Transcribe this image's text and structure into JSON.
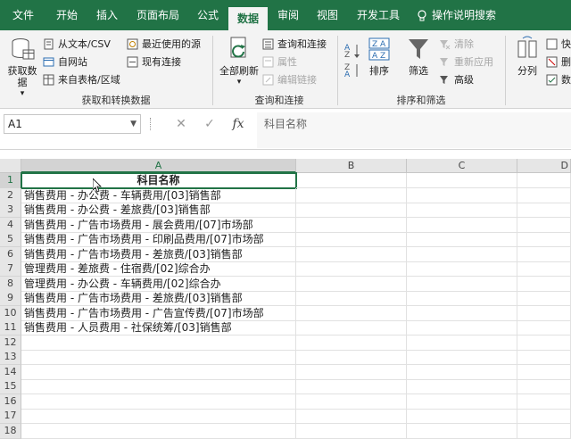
{
  "ribbon_tabs": [
    "文件",
    "开始",
    "插入",
    "页面布局",
    "公式",
    "数据",
    "审阅",
    "视图",
    "开发工具",
    "操作说明搜索"
  ],
  "active_tab": "数据",
  "colors": {
    "brand": "#217346",
    "ribbon_bg": "#f3f3f3",
    "header_bg": "#e6e6e6",
    "grid_line": "#e1e1e1",
    "disabled": "#a6a6a6"
  },
  "groups": {
    "get_data": {
      "label": "获取和转换数据",
      "get_data_btn": "获取数据",
      "from_text": "从文本/CSV",
      "from_web": "自网站",
      "from_table": "来自表格/区域",
      "recent_sources": "最近使用的源",
      "existing_connections": "现有连接"
    },
    "queries": {
      "label": "查询和连接",
      "refresh_all": "全部刷新",
      "queries_connections": "查询和连接",
      "properties": "属性",
      "edit_links": "编辑链接"
    },
    "sort_filter": {
      "label": "排序和筛选",
      "sort": "排序",
      "filter": "筛选",
      "clear": "清除",
      "reapply": "重新应用",
      "advanced": "高级"
    },
    "data_tools": {
      "split": "分列",
      "quick": "快",
      "remove": "删",
      "validate": "数"
    }
  },
  "formula_bar": {
    "name_box": "A1",
    "cancel": "✕",
    "enter": "✓",
    "fx": "fx",
    "content": "科目名称"
  },
  "columns": [
    "A",
    "B",
    "C",
    "D"
  ],
  "rows": [
    {
      "num": "1",
      "a": "科目名称"
    },
    {
      "num": "2",
      "a": "销售费用 - 办公费 - 车辆费用/[03]销售部"
    },
    {
      "num": "3",
      "a": "销售费用 - 办公费 - 差旅费/[03]销售部"
    },
    {
      "num": "4",
      "a": "销售费用 - 广告市场费用 - 展会费用/[07]市场部"
    },
    {
      "num": "5",
      "a": "销售费用 - 广告市场费用 - 印刷品费用/[07]市场部"
    },
    {
      "num": "6",
      "a": "销售费用 - 广告市场费用 - 差旅费/[03]销售部"
    },
    {
      "num": "7",
      "a": "管理费用 - 差旅费 - 住宿费/[02]综合办"
    },
    {
      "num": "8",
      "a": "管理费用 - 办公费 - 车辆费用/[02]综合办"
    },
    {
      "num": "9",
      "a": "销售费用 - 广告市场费用 - 差旅费/[03]销售部"
    },
    {
      "num": "10",
      "a": "销售费用 - 广告市场费用 - 广告宣传费/[07]市场部"
    },
    {
      "num": "11",
      "a": "销售费用 - 人员费用 - 社保统筹/[03]销售部"
    },
    {
      "num": "12",
      "a": ""
    },
    {
      "num": "13",
      "a": ""
    },
    {
      "num": "14",
      "a": ""
    },
    {
      "num": "15",
      "a": ""
    },
    {
      "num": "16",
      "a": ""
    },
    {
      "num": "17",
      "a": ""
    },
    {
      "num": "18",
      "a": ""
    }
  ]
}
